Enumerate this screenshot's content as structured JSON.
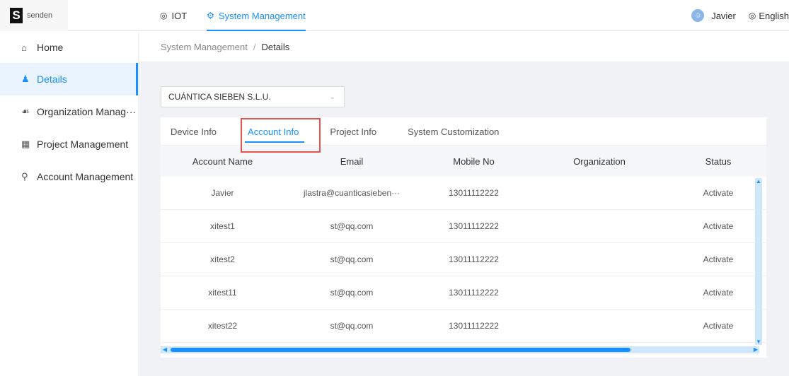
{
  "brand": {
    "mark": "S",
    "text": "senden"
  },
  "topnav": [
    {
      "icon": "globe-icon",
      "label": "IOT"
    },
    {
      "icon": "gear-icon",
      "label": "System Management"
    }
  ],
  "user": {
    "name": "Javier",
    "language": "English"
  },
  "sidebar": {
    "items": [
      {
        "icon": "home-icon",
        "label": "Home"
      },
      {
        "icon": "details-icon",
        "label": "Details"
      },
      {
        "icon": "org-icon",
        "label": "Organization Manag···"
      },
      {
        "icon": "grid-icon",
        "label": "Project Management"
      },
      {
        "icon": "user-icon",
        "label": "Account Management"
      }
    ]
  },
  "breadcrumb": {
    "parent": "System Management",
    "separator": "/",
    "current": "Details"
  },
  "company_select": {
    "value": "CUÁNTICA SIEBEN S.L.U."
  },
  "tabs": [
    "Device Info",
    "Account Info",
    "Project Info",
    "System Customization"
  ],
  "table": {
    "headers": [
      "Account Name",
      "Email",
      "Mobile No",
      "Organization",
      "Status"
    ],
    "rows": [
      [
        "Javier",
        "jlastra@cuanticasieben···",
        "13011112222",
        "",
        "Activate"
      ],
      [
        "xitest1",
        "st@qq.com",
        "13011112222",
        "",
        "Activate"
      ],
      [
        "xitest2",
        "st@qq.com",
        "13011112222",
        "",
        "Activate"
      ],
      [
        "xitest11",
        "st@qq.com",
        "13011112222",
        "",
        "Activate"
      ],
      [
        "xitest22",
        "st@qq.com",
        "13011112222",
        "",
        "Activate"
      ]
    ]
  },
  "colors": {
    "accent": "#1890ff",
    "highlight": "#e5534b"
  }
}
